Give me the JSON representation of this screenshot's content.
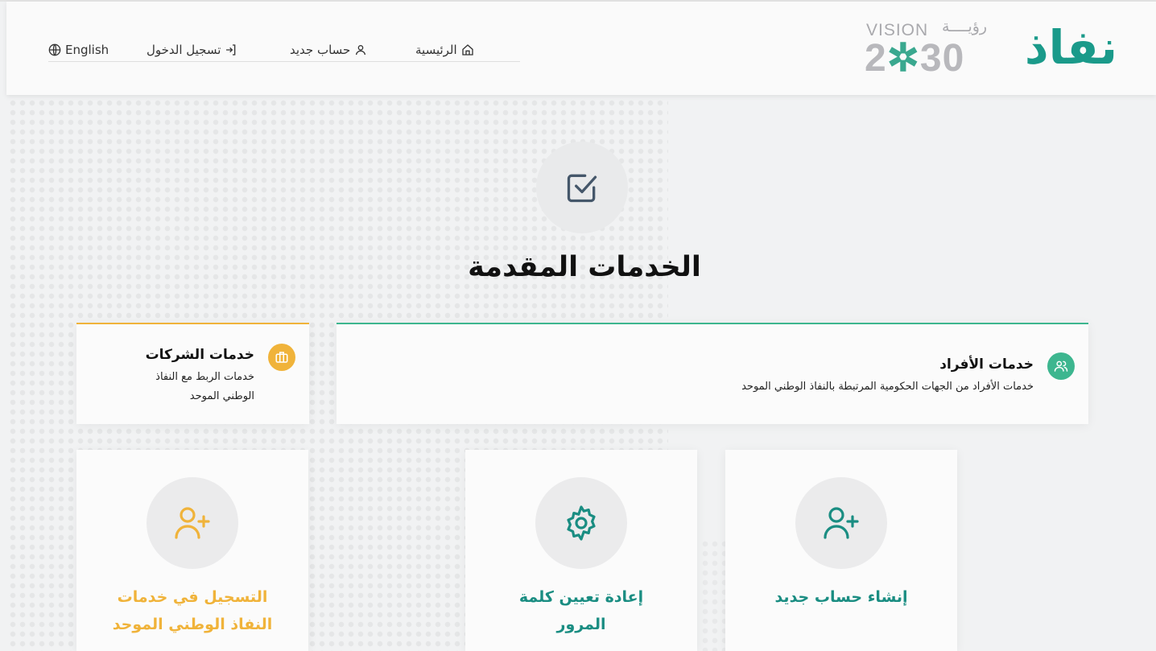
{
  "header": {
    "logo": {
      "text": "نفاذ",
      "color": "#1a9a8a"
    },
    "vision": {
      "word": "VISION",
      "arabic": "رؤيــــة",
      "year_left": "2",
      "year_mark": "✲",
      "year_right": "30"
    },
    "nav": [
      {
        "label": "English",
        "icon": "globe-icon"
      },
      {
        "label": "تسجيل الدخول",
        "icon": "login-icon"
      },
      {
        "label": "حساب جديد",
        "icon": "user-icon"
      },
      {
        "label": "الرئيسية",
        "icon": "home-icon"
      }
    ]
  },
  "hero": {
    "icon": "checkbox-icon",
    "title": "الخدمات المقدمة"
  },
  "services": {
    "individuals": {
      "title": "خدمات الأفراد",
      "description": "خدمات الأفراد من الجهات الحكومية المرتبطة بالنفاذ الوطني الموحد",
      "icon": "users-icon",
      "accent": "#3db68f"
    },
    "business": {
      "title": "خدمات الشركات",
      "description_line1": "خدمات الربط مع النفاذ",
      "description_line2": "الوطني الموحد",
      "icon": "briefcase-icon",
      "accent": "#f0b33a"
    }
  },
  "cards": [
    {
      "label": "إنشاء حساب جديد",
      "icon": "user-plus-icon",
      "color": "#1a8d82"
    },
    {
      "label_line1": "إعادة تعيين كلمة",
      "label_line2": "المرور",
      "icon": "gear-icon",
      "color": "#1a8d82"
    },
    {
      "label_line1": "التسجيل في خدمات",
      "label_line2": "النفاذ الوطني الموحد",
      "icon": "user-plus-icon",
      "color": "#f0b33a"
    }
  ]
}
